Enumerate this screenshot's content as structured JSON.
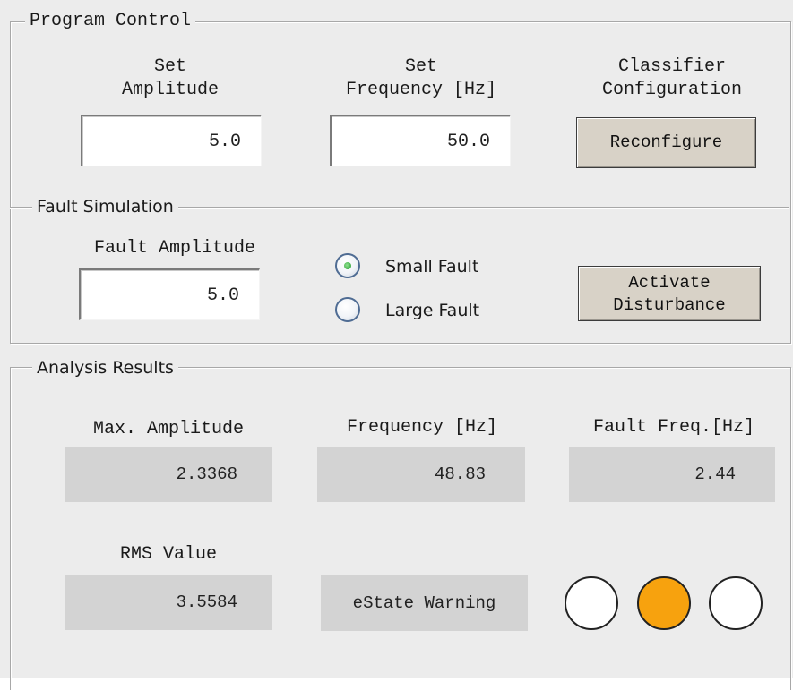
{
  "program_control": {
    "title": "Program Control",
    "set_amplitude": {
      "label_line1": "Set",
      "label_line2": "Amplitude",
      "value": "5.0"
    },
    "set_frequency": {
      "label_line1": "Set",
      "label_line2": "Frequency [Hz]",
      "value": "50.0"
    },
    "classifier": {
      "label_line1": "Classifier",
      "label_line2": "Configuration",
      "button_label": "Reconfigure"
    }
  },
  "fault_simulation": {
    "title": "Fault Simulation",
    "fault_amplitude": {
      "label": "Fault Amplitude",
      "value": "5.0"
    },
    "radio_options": [
      {
        "label": "Small Fault",
        "selected": true
      },
      {
        "label": "Large Fault",
        "selected": false
      }
    ],
    "activate_button": {
      "line1": "Activate",
      "line2": "Disturbance"
    }
  },
  "analysis_results": {
    "title": "Analysis Results",
    "max_amplitude": {
      "label": "Max. Amplitude",
      "value": "2.3368"
    },
    "frequency": {
      "label": "Frequency [Hz]",
      "value": "48.83"
    },
    "fault_freq": {
      "label": "Fault Freq.[Hz]",
      "value": "2.44"
    },
    "rms_value": {
      "label": "RMS Value",
      "value": "3.5584"
    },
    "state": {
      "value": "eState_Warning"
    },
    "lamps": [
      {
        "name": "lamp-1",
        "color": "#ffffff"
      },
      {
        "name": "lamp-2",
        "color": "#f7a20e"
      },
      {
        "name": "lamp-3",
        "color": "#ffffff"
      }
    ]
  }
}
